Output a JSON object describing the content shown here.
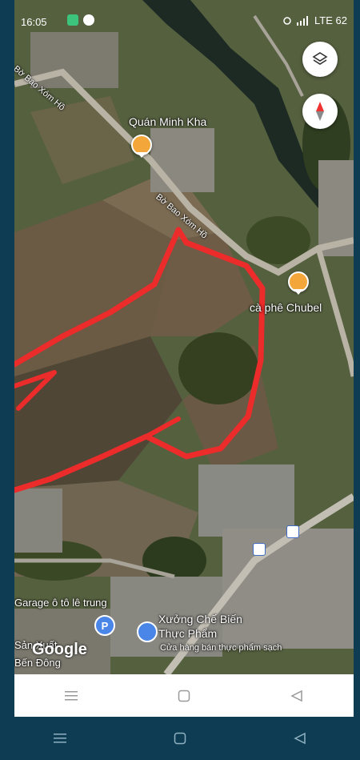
{
  "status_bar": {
    "time": "16:05",
    "right_text": "LTE 62"
  },
  "map": {
    "places": {
      "quan_minh_kha": "Quán Minh Kha",
      "ca_phe_chubel": "cà phê Chubel",
      "garage": "Garage ô tô lê trung",
      "xuong_title_1": "Xưởng Chế Biến",
      "xuong_title_2": "Thực Phẩm",
      "xuong_sub": "Cửa hàng bán thực phẩm sạch",
      "san_xuat_1": "Sản Xuất",
      "san_xuat_2": "Bến Đông"
    },
    "roads": {
      "bo_bao_xom_ho_1": "Bờ Bao Xóm Hồ",
      "bo_bao_xom_ho_2": "Bờ Bao Xóm Hồ"
    },
    "google_logo": "Google",
    "parking_letter": "P",
    "route_color": "#ec2b2b"
  },
  "icons": {
    "layers": "layers-icon",
    "compass": "compass-icon",
    "app_nav": [
      "menu-icon",
      "home-icon",
      "back-icon"
    ],
    "system_nav": [
      "menu-icon",
      "home-icon",
      "back-icon"
    ]
  }
}
